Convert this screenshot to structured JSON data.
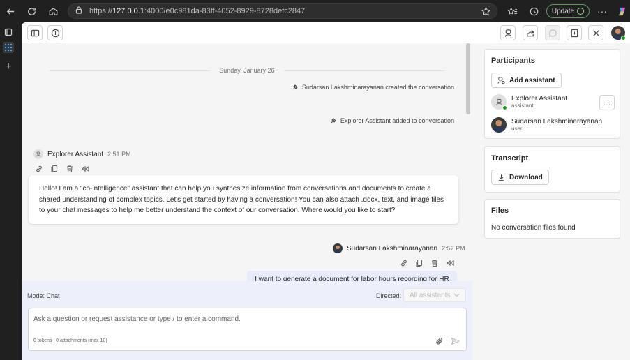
{
  "browser": {
    "url_prefix": "https://",
    "url_host": "127.0.0.1",
    "url_rest": ":4000/e0c981da-83ff-4052-8929-8728defc2847",
    "update_label": "Update"
  },
  "chat": {
    "date_divider": "Sunday, January 26",
    "system_messages": [
      "Sudarsan Lakshminarayanan created the conversation",
      "Explorer Assistant added to conversation"
    ],
    "assistant_message": {
      "sender": "Explorer Assistant",
      "time": "2:51 PM",
      "text": "Hello! I am a \"co-intelligence\" assistant that can help you synthesize information from conversations and documents to create a shared understanding of complex topics. Let's get started by having a conversation! You can also attach .docx, text, and image files to your chat messages to help me better understand the context of our conversation. Where would you like to start?"
    },
    "user_message": {
      "sender": "Sudarsan Lakshminarayanan",
      "time": "2:52 PM",
      "text": "I want to generate a document for labor hours recording for HR"
    }
  },
  "composer": {
    "mode_label": "Mode: Chat",
    "directed_label": "Directed:",
    "directed_value": "All assistants",
    "placeholder": "Ask a question or request assistance or type / to enter a command.",
    "meta": "0 tokens | 0 attachments (max 10)"
  },
  "panel": {
    "participants_title": "Participants",
    "add_assistant_label": "Add assistant",
    "participants": [
      {
        "name": "Explorer Assistant",
        "role": "assistant"
      },
      {
        "name": "Sudarsan Lakshminarayanan",
        "role": "user"
      }
    ],
    "more_label": "···",
    "transcript_title": "Transcript",
    "download_label": "Download",
    "files_title": "Files",
    "files_empty": "No conversation files found"
  }
}
